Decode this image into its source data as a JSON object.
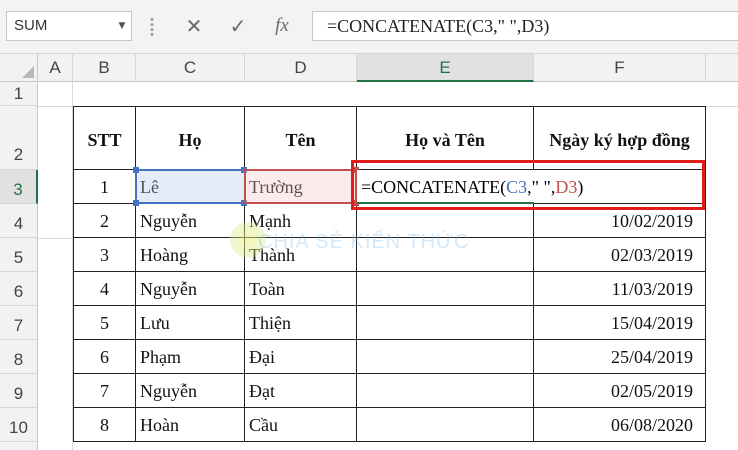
{
  "formula_bar": {
    "name_box": "SUM",
    "formula": "=CONCATENATE(C3,\" \",D3)",
    "icons": [
      "cancel-icon",
      "enter-icon",
      "fx-icon"
    ]
  },
  "columns": [
    "A",
    "B",
    "C",
    "D",
    "E",
    "F"
  ],
  "rows": [
    "1",
    "2",
    "3",
    "4",
    "5",
    "6",
    "7",
    "8",
    "9",
    "10"
  ],
  "headers": {
    "stt": "STT",
    "ho": "Họ",
    "ten": "Tên",
    "ho_va_ten": "Họ và Tên",
    "ngay": "Ngày ký hợp đồng"
  },
  "data_rows": [
    {
      "stt": "1",
      "ho": "Lê",
      "ten": "Trường",
      "ngay": ""
    },
    {
      "stt": "2",
      "ho": "Nguyễn",
      "ten": "Mạnh",
      "ngay": "10/02/2019"
    },
    {
      "stt": "3",
      "ho": "Hoàng",
      "ten": "Thành",
      "ngay": "02/03/2019"
    },
    {
      "stt": "4",
      "ho": "Nguyễn",
      "ten": "Toàn",
      "ngay": "11/03/2019"
    },
    {
      "stt": "5",
      "ho": "Lưu",
      "ten": "Thiện",
      "ngay": "15/04/2019"
    },
    {
      "stt": "6",
      "ho": "Phạm",
      "ten": "Đại",
      "ngay": "25/04/2019"
    },
    {
      "stt": "7",
      "ho": "Nguyễn",
      "ten": "Đạt",
      "ngay": "02/05/2019"
    },
    {
      "stt": "8",
      "ho": "Hoàn",
      "ten": "Cầu",
      "ngay": "06/08/2020"
    }
  ],
  "editing_cell": {
    "prefix": "=CONCATENATE(",
    "ref1": "C3",
    "middle": ",\" \",",
    "ref2": "D3",
    "suffix": ")"
  },
  "watermark": "CHIA SẺ KIẾN THỨC",
  "colors": {
    "ref1": "#4472c4",
    "ref2": "#c0504d",
    "highlight_box": "#e21b1b",
    "active_header": "#217346"
  }
}
